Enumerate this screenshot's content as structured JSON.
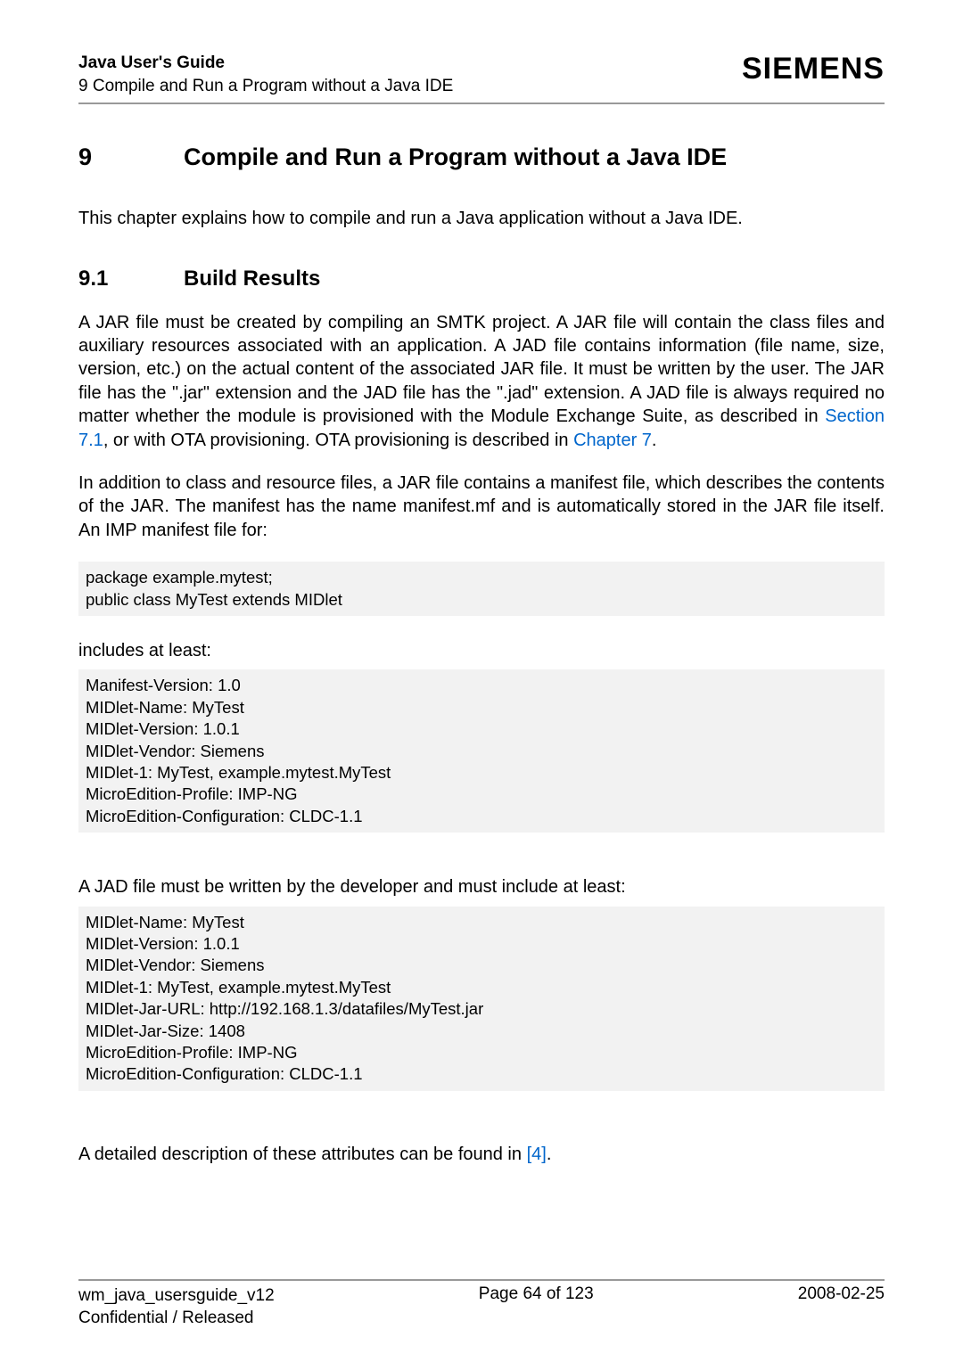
{
  "header": {
    "title": "Java User's Guide",
    "subtitle": "9 Compile and Run a Program without a Java IDE",
    "logo": "SIEMENS"
  },
  "section9": {
    "number": "9",
    "title": "Compile and Run a Program without a Java IDE",
    "intro": "This chapter explains how to compile and run a Java application without a Java IDE."
  },
  "section91": {
    "number": "9.1",
    "title": "Build Results",
    "para1_a": "A JAR file must be created by compiling an SMTK project. A JAR file will contain the class files and auxiliary resources associated with an application. A JAD file contains information (file name, size, version, etc.) on the actual content of the associated JAR file. It must be written by the user. The JAR file has the \".jar\" extension and the JAD file has the \".jad\" extension. A JAD file is always required no matter whether the module is provisioned with the Module Exchange Suite, as described in ",
    "link1": "Section 7.1",
    "para1_b": ", or with OTA provisioning. OTA provisioning is described in ",
    "link2": "Chapter 7",
    "para1_c": ".",
    "para2": "In addition to class and resource files, a JAR file contains a manifest file, which describes the contents of the JAR. The manifest has the name manifest.mf and is automatically stored in the JAR file itself. An IMP manifest file for:",
    "code1": "package example.mytest;\npublic class MyTest extends MIDlet",
    "includes": "includes at least:",
    "code2": "Manifest-Version: 1.0\nMIDlet-Name: MyTest\nMIDlet-Version: 1.0.1\nMIDlet-Vendor: Siemens\nMIDlet-1: MyTest, example.mytest.MyTest\nMicroEdition-Profile: IMP-NG\nMicroEdition-Configuration: CLDC-1.1",
    "para3": "A JAD file must be written by the developer and must include at least:",
    "code3": "MIDlet-Name: MyTest\nMIDlet-Version: 1.0.1\nMIDlet-Vendor: Siemens\nMIDlet-1: MyTest, example.mytest.MyTest\nMIDlet-Jar-URL: http://192.168.1.3/datafiles/MyTest.jar\nMIDlet-Jar-Size: 1408\nMicroEdition-Profile: IMP-NG\nMicroEdition-Configuration: CLDC-1.1",
    "para4_a": "A detailed description of these attributes can be found in ",
    "link3": "[4]",
    "para4_b": "."
  },
  "footer": {
    "left1": "wm_java_usersguide_v12",
    "left2": "Confidential / Released",
    "center": "Page 64 of 123",
    "right": "2008-02-25"
  }
}
